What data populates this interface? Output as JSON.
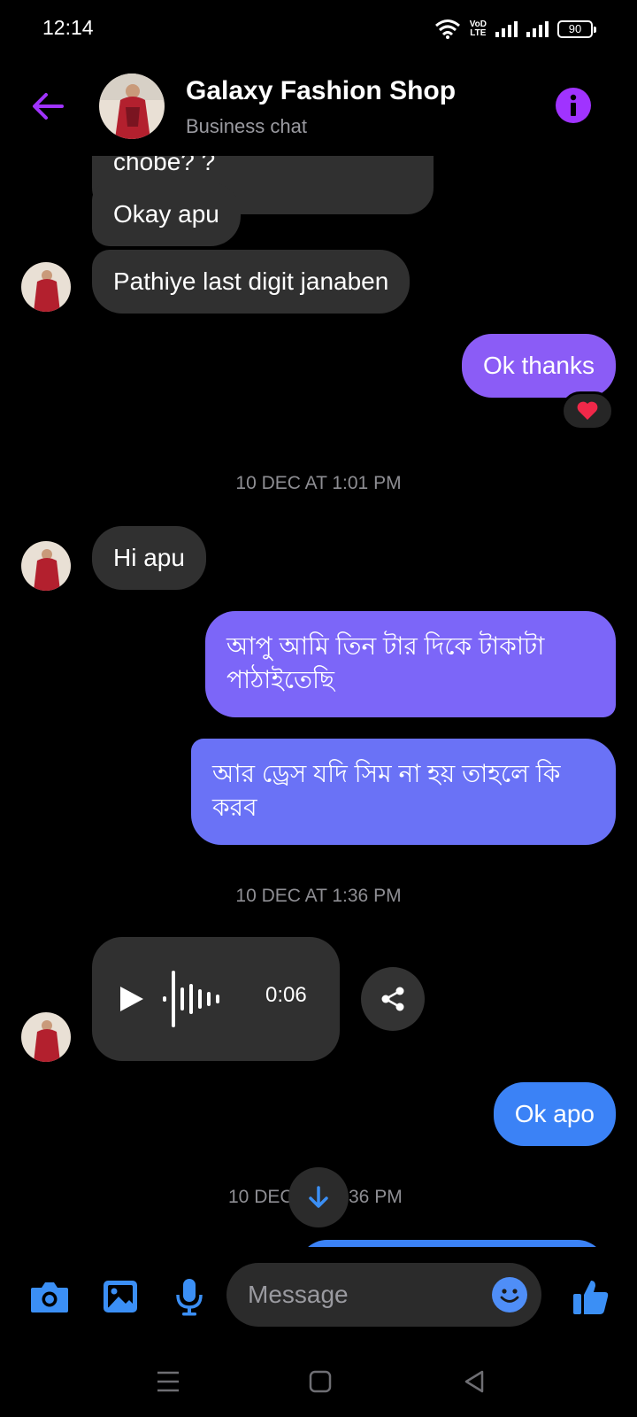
{
  "status_bar": {
    "time": "12:14",
    "volte_line1": "VoD",
    "volte_line2": "LTE",
    "battery": "90"
  },
  "header": {
    "title": "Galaxy Fashion Shop",
    "subtitle": "Business chat"
  },
  "messages": {
    "clipped_text": "chobe? ?",
    "in_1": "Okay apu",
    "in_2": "Pathiye last digit janaben",
    "out_1": "Ok thanks",
    "out_1_reaction": "❤",
    "ts_1": "10 DEC AT 1:01 PM",
    "in_3": "Hi apu",
    "out_2": "আপু আমি তিন টার দিকে টাকাটা পাঠাইতেছি",
    "out_3": "আর ড্রেস যদি সিম না হয় তাহলে কি করব",
    "ts_2": "10 DEC AT 1:36 PM",
    "voice_duration": "0:06",
    "out_4": "Ok apo",
    "ts_3_left": "10 DEC",
    "ts_3_right": "36 PM"
  },
  "composer": {
    "placeholder": "Message"
  },
  "icons": [
    "back-arrow-icon",
    "info-icon",
    "heart-icon",
    "play-icon",
    "share-icon",
    "arrow-down-icon",
    "camera-icon",
    "image-icon",
    "mic-icon",
    "emoji-icon",
    "thumbs-up-icon"
  ],
  "colors": {
    "accent": "#a033ff",
    "outgoing_purple": "#8b5cf6",
    "outgoing_blue": "#3b82f6",
    "incoming": "#303030"
  }
}
